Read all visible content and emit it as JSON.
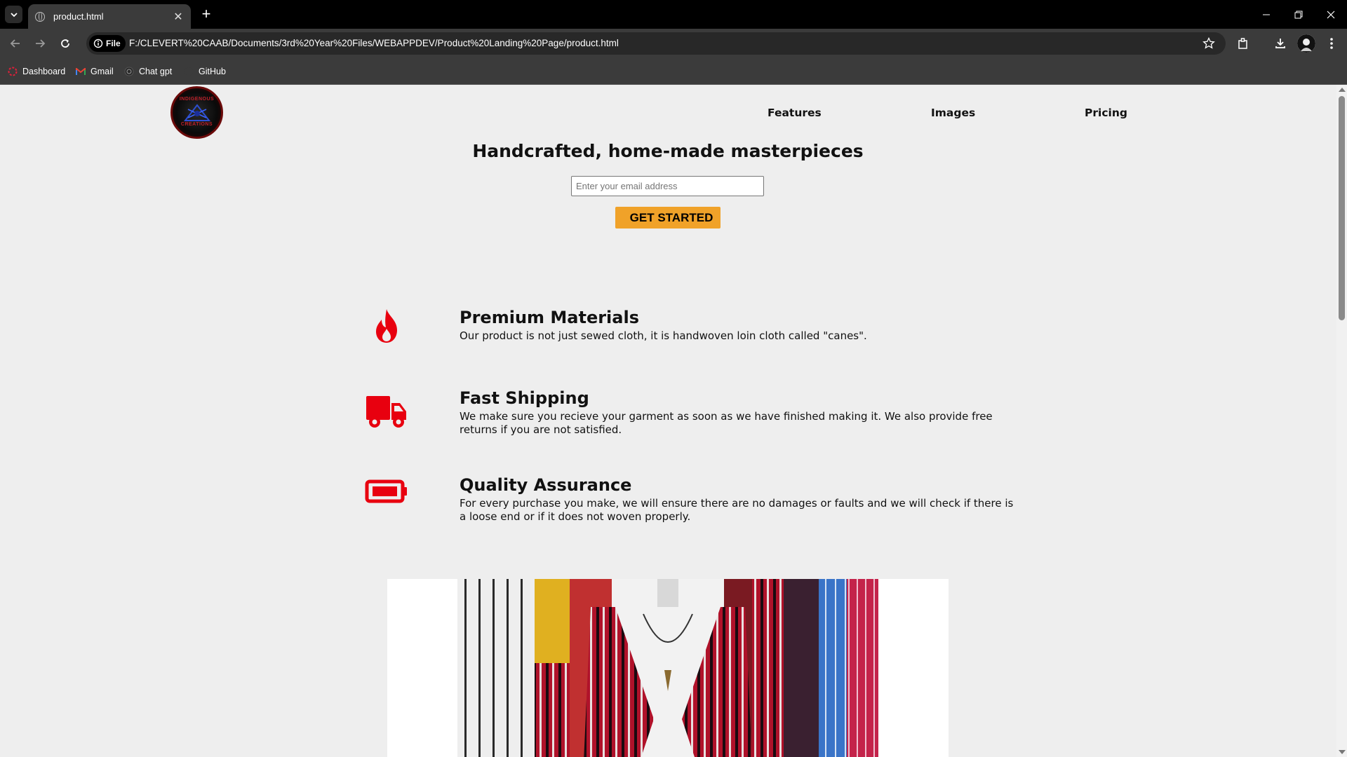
{
  "browser": {
    "tab_title": "product.html",
    "site_chip_label": "File",
    "url": "F:/CLEVERT%20CAAB/Documents/3rd%20Year%20Files/WEBAPPDEV/Product%20Landing%20Page/product.html",
    "bookmarks": [
      {
        "label": "Dashboard",
        "icon": "dashboard-icon"
      },
      {
        "label": "Gmail",
        "icon": "gmail-icon"
      },
      {
        "label": "Chat gpt",
        "icon": "chatgpt-icon"
      },
      {
        "label": "GitHub",
        "icon": "github-icon"
      }
    ]
  },
  "page": {
    "logo": {
      "top_text": "INDIGENOUS",
      "bottom_text": "CREATIONS"
    },
    "nav": [
      {
        "label": "Features"
      },
      {
        "label": "Images"
      },
      {
        "label": "Pricing"
      }
    ],
    "hero": {
      "title": "Handcrafted, home-made masterpieces",
      "email_placeholder": "Enter your email address",
      "cta_label": "GET STARTED"
    },
    "features": [
      {
        "icon": "fire-icon",
        "title": "Premium Materials",
        "description": "Our product is not just sewed cloth, it is handwoven loin cloth called \"canes\"."
      },
      {
        "icon": "truck-icon",
        "title": "Fast Shipping",
        "description": "We make sure you recieve your garment as soon as we have finished making it. We also provide free returns if you are not satisfied."
      },
      {
        "icon": "battery-icon",
        "title": "Quality Assurance",
        "description": "For every purchase you make, we will ensure there are no damages or faults and we will check if there is a loose end or if it does not woven properly."
      }
    ],
    "accent_color": "#e8000f",
    "cta_color": "#f0a229"
  }
}
